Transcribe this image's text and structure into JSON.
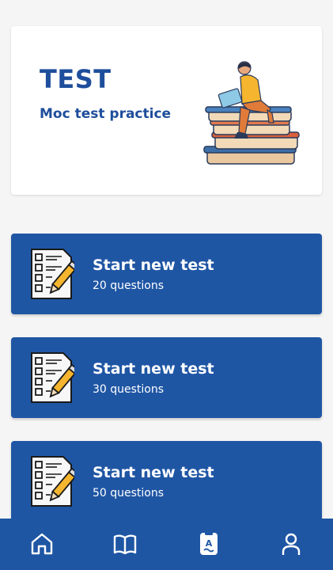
{
  "hero": {
    "title": "TEST",
    "subtitle": "Moc test practice",
    "illustration": "person-reading-on-books-illustration"
  },
  "tests": [
    {
      "title": "Start new test",
      "subtitle": "20 questions",
      "icon": "test-sheet-pencil-icon"
    },
    {
      "title": "Start new test",
      "subtitle": "30 questions",
      "icon": "test-sheet-pencil-icon"
    },
    {
      "title": "Start new test",
      "subtitle": "50 questions",
      "icon": "test-sheet-pencil-icon"
    }
  ],
  "nav": {
    "items": [
      {
        "icon": "home-icon"
      },
      {
        "icon": "book-icon"
      },
      {
        "icon": "quiz-icon",
        "active": true
      },
      {
        "icon": "profile-icon"
      }
    ]
  },
  "colors": {
    "primary": "#1f56a4",
    "title_text": "#1e4e9c",
    "background": "#f5f5f5",
    "card_text": "#ffffff"
  }
}
